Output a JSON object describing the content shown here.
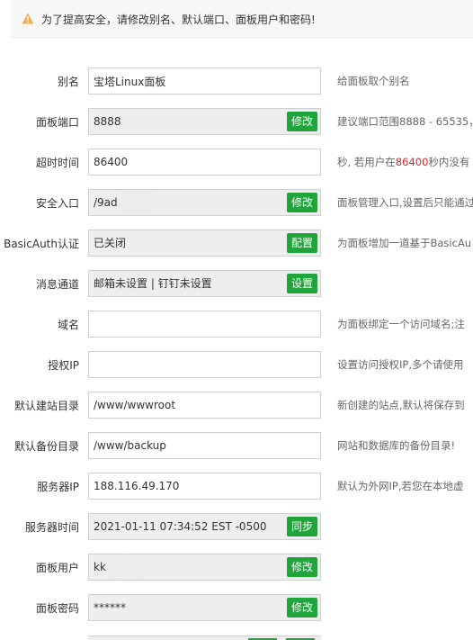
{
  "warning": {
    "icon": "warning-triangle-icon",
    "icon_color": "#f0ad4e",
    "text": "为了提高安全，请修改别名、默认端口、面板用户和密码!"
  },
  "accent_color": "#20a53a",
  "rows": {
    "alias": {
      "label": "别名",
      "value": "宝塔Linux面板",
      "hint": "给面板取个别名"
    },
    "port": {
      "label": "面板端口",
      "value": "8888",
      "button": "修改",
      "hint": "建议端口范围8888 - 65535，"
    },
    "timeout": {
      "label": "超时时间",
      "value": "86400",
      "hint_a": "秒, 若用户在",
      "hint_red": "86400",
      "hint_b": "秒内没有"
    },
    "entry": {
      "label": "安全入口",
      "value": "/9ad",
      "button": "修改",
      "hint": "面板管理入口,设置后只能通过"
    },
    "basicauth": {
      "label": "BasicAuth认证",
      "value": "已关闭",
      "button": "配置",
      "hint": "为面板增加一道基于BasicAu"
    },
    "message": {
      "label": "消息通道",
      "value": "邮箱未设置 | 钉钉未设置",
      "button": "设置"
    },
    "domain": {
      "label": "域名",
      "value": "",
      "hint": "为面板绑定一个访问域名;注"
    },
    "ip": {
      "label": "授权IP",
      "value": "",
      "hint": "设置访问授权IP,多个请使用"
    },
    "site_dir": {
      "label": "默认建站目录",
      "value": "/www/wwwroot",
      "hint": "新创建的站点,默认将保存到"
    },
    "backup_dir": {
      "label": "默认备份目录",
      "value": "/www/backup",
      "hint": "网站和数据库的备份目录!"
    },
    "server_ip": {
      "label": "服务器IP",
      "value": "188.116.49.170",
      "hint": "默认为外网IP,若您在本地虚"
    },
    "server_time": {
      "label": "服务器时间",
      "value": "2021-01-11 07:34:52 EST -0500",
      "button": "同步"
    },
    "user": {
      "label": "面板用户",
      "value": "kk",
      "button": "修改"
    },
    "password": {
      "label": "面板密码",
      "value": "******",
      "button": "修改"
    }
  }
}
